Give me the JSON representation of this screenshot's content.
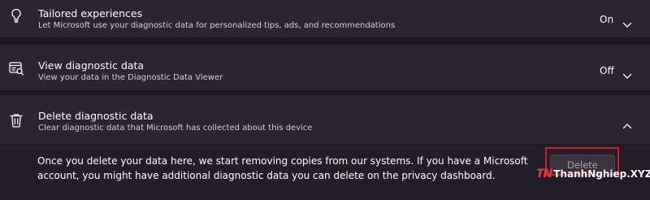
{
  "rows": [
    {
      "title": "Tailored experiences",
      "description": "Let Microsoft use your diagnostic data for personalized tips, ads, and recommendations",
      "value": "On",
      "icon": "lightbulb-icon",
      "expanded": false
    },
    {
      "title": "View diagnostic data",
      "description": "View your data in the Diagnostic Data Viewer",
      "value": "Off",
      "icon": "diagnostic-viewer-icon",
      "expanded": false
    },
    {
      "title": "Delete diagnostic data",
      "description": "Clear diagnostic data that Microsoft has collected about this device",
      "value": "",
      "icon": "trash-icon",
      "expanded": true
    }
  ],
  "delete_panel": {
    "text": "Once you delete your data here, we start removing copies from our systems. If you have a Microsoft account, you might have additional diagnostic data you can delete on the privacy dashboard.",
    "button_label": "Delete",
    "highlight_color": "#d0202a"
  },
  "watermark": {
    "logo": "TN",
    "text": "ThanhNghiep.XYZ"
  },
  "colors": {
    "background": "#1c1721",
    "card": "#2b2431",
    "text_primary": "#ffffff",
    "text_secondary": "#d5d0d8"
  }
}
